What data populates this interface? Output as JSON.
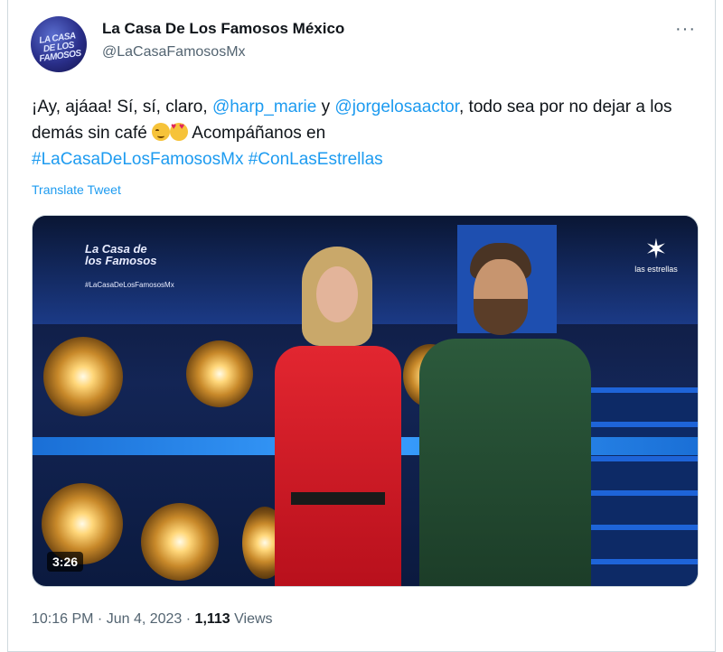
{
  "tweet": {
    "author_name": "La Casa De Los Famosos México",
    "author_handle": "@LaCasaFamososMx",
    "avatar_text": "LA CASA DE LOS FAMOSOS",
    "more_label": "···",
    "text_parts": {
      "p1": "¡Ay, ajáaa! Sí, sí, claro, ",
      "mention1": "@harp_marie",
      "p2": " y ",
      "mention2": "@jorgelosaactor",
      "p3": ", todo sea por no dejar a los demás sin café ",
      "p4": "  Acompáñanos en ",
      "hashtag1": "#LaCasaDeLosFamososMx",
      "p5": " ",
      "hashtag2": "#ConLasEstrellas"
    },
    "emojis": [
      "relieved-face-emoji",
      "heart-eyes-emoji"
    ],
    "translate_label": "Translate Tweet",
    "media": {
      "show_logo_text": "La Casa de los Famosos",
      "show_hashtag": "#LaCasaDeLosFamososMx",
      "network_logo_label": "las estrellas",
      "duration": "3:26"
    },
    "meta": {
      "time": "10:16 PM",
      "sep1": " · ",
      "date": "Jun 4, 2023",
      "sep2": " · ",
      "views_count": "1,113",
      "views_label": " Views"
    }
  }
}
